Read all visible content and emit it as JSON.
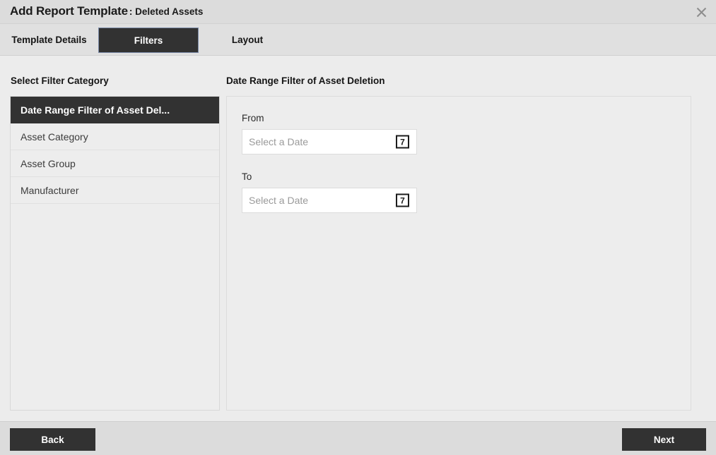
{
  "window": {
    "title": "Add Report Template",
    "subtitle": ": Deleted Assets",
    "close_icon": "close-icon"
  },
  "tabs": [
    {
      "label": "Template Details",
      "selected": false
    },
    {
      "label": "Filters",
      "selected": true
    },
    {
      "label": "Layout",
      "selected": false
    }
  ],
  "sidebar": {
    "heading": "Select Filter Category",
    "items": [
      {
        "label": "Date Range Filter of Asset Del...",
        "selected": true
      },
      {
        "label": "Asset Category",
        "selected": false
      },
      {
        "label": "Asset Group",
        "selected": false
      },
      {
        "label": "Manufacturer",
        "selected": false
      }
    ]
  },
  "panel": {
    "title": "Date Range Filter of Asset Deletion",
    "fields": [
      {
        "label": "From",
        "value": "",
        "placeholder": "Select a Date",
        "icon": "calendar-icon",
        "icon_glyph": "7"
      },
      {
        "label": "To",
        "value": "",
        "placeholder": "Select a Date",
        "icon": "calendar-icon",
        "icon_glyph": "7"
      }
    ]
  },
  "footer": {
    "back_label": "Back",
    "next_label": "Next"
  },
  "colors": {
    "accent_dark": "#323232",
    "tab_border": "#7b8ba8",
    "titlebar_bg": "#dcdcdc",
    "tabbar_bg": "#e0e0e0",
    "body_bg": "#ececec",
    "panel_bg": "#ededed"
  }
}
